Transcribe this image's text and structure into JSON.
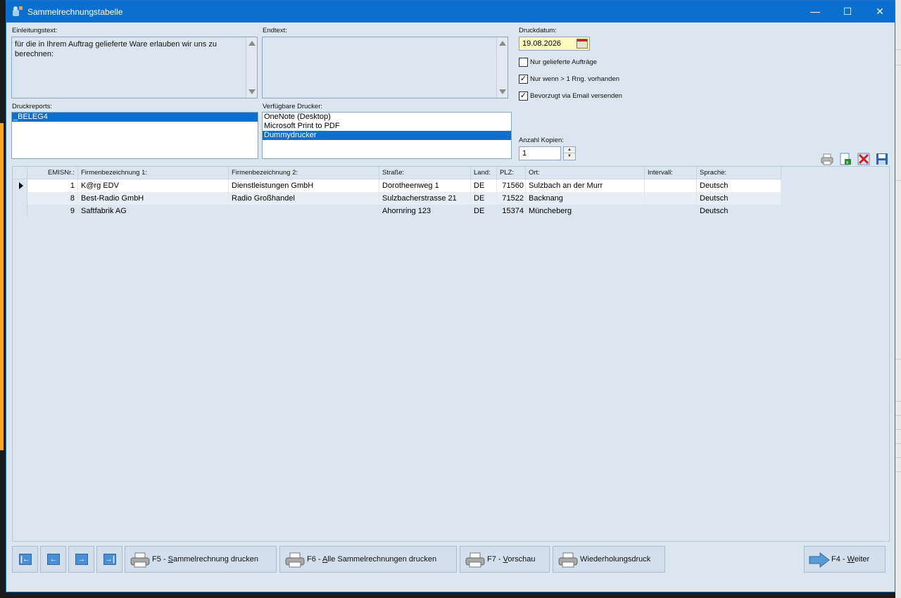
{
  "window": {
    "title": "Sammelrechnungstabelle",
    "minimize_glyph": "—",
    "maximize_glyph": "☐",
    "close_glyph": "✕"
  },
  "intro": {
    "label": "Einleitungstext:",
    "text": "für die in Ihrem Auftrag gelieferte Ware erlauben wir uns zu berechnen:"
  },
  "endtext": {
    "label": "Endtext:",
    "text": ""
  },
  "print_date": {
    "label": "Druckdatum:",
    "value": "19.08.2026"
  },
  "checkboxes": [
    {
      "label": "Nur gelieferte Aufträge",
      "checked": false
    },
    {
      "label": "Nur wenn > 1 Rng. vorhanden",
      "checked": true
    },
    {
      "label": "Bevorzugt via Email versenden",
      "checked": true
    }
  ],
  "reports": {
    "label": "Druckreports:",
    "items": [
      "_BELEG4"
    ],
    "selected": 0
  },
  "printers": {
    "label": "Verfügbare Drucker:",
    "items": [
      "OneNote (Desktop)",
      "Microsoft Print to PDF",
      "Dummydrucker"
    ],
    "selected": 2
  },
  "copies": {
    "label": "Anzahl Kopien:",
    "value": "1"
  },
  "grid": {
    "columns": [
      "EMISNr.:",
      "Firmenbezeichnung 1:",
      "Firmenbezeichnung 2:",
      "Straße:",
      "Land:",
      "PLZ:",
      "Ort:",
      "Intervall:",
      "Sprache:"
    ],
    "rows": [
      [
        "1",
        "K@rg EDV",
        "Dienstleistungen GmbH",
        "Dorotheenweg 1",
        "DE",
        "71560",
        "Sulzbach an der Murr",
        "",
        "Deutsch"
      ],
      [
        "8",
        "Best-Radio GmbH",
        "Radio Großhandel",
        "Sulzbacherstrasse 21",
        "DE",
        "71522",
        "Backnang",
        "",
        "Deutsch"
      ],
      [
        "9",
        "Saftfabrik AG",
        "",
        "Ahornring 123",
        "DE",
        "15374",
        "Müncheberg",
        "",
        "Deutsch"
      ]
    ],
    "current_row": 0
  },
  "nav": {
    "first_glyph": "|←",
    "prev_glyph": "←",
    "next_glyph": "→",
    "last_glyph": "→|"
  },
  "buttons": {
    "f5_key": "F5 - ",
    "f5_ul": "S",
    "f5_rest": "ammelrechnung drucken",
    "f6_key": "F6 - ",
    "f6_ul": "A",
    "f6_rest": "lle Sammelrechnungen drucken",
    "f7_key": "F7 - ",
    "f7_ul": "V",
    "f7_rest": "orschau",
    "repeat": "Wiederholungsdruck",
    "f4_key": "F4 - ",
    "f4_ul": "W",
    "f4_rest": "eiter"
  },
  "colors": {
    "titlebar": "#0a6fcf",
    "selection": "#0a6fcf",
    "background": "#dce6f1",
    "date_field": "#fff9c4"
  }
}
